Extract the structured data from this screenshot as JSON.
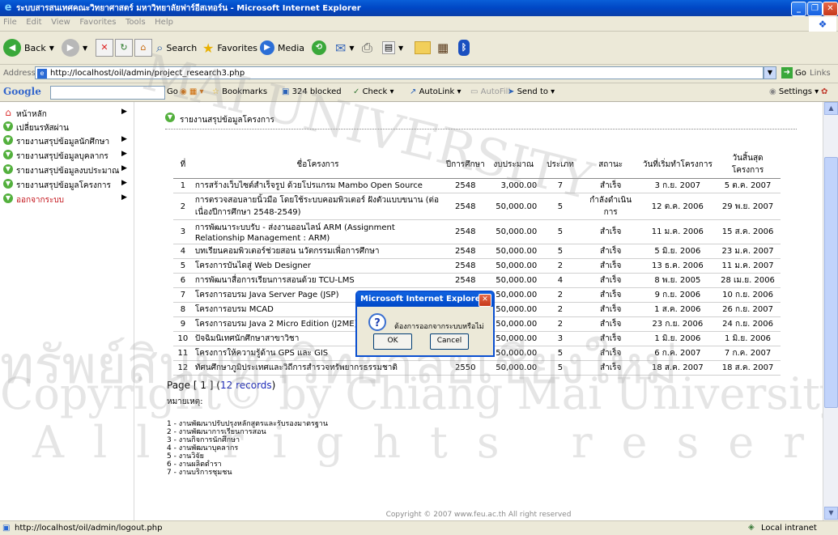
{
  "window": {
    "title": "ระบบสารสนเทศคณะวิทยาศาสตร์ มหาวิทยาลัยฟาร์อีสเทอร์น - Microsoft Internet Explorer"
  },
  "menu": [
    "File",
    "Edit",
    "View",
    "Favorites",
    "Tools",
    "Help"
  ],
  "toolbar": {
    "back": "Back",
    "search": "Search",
    "favorites": "Favorites",
    "media": "Media"
  },
  "address": {
    "label": "Address",
    "url": "http://localhost/oil/admin/project_research3.php",
    "go": "Go",
    "links": "Links"
  },
  "googlebar": {
    "logo": "Google",
    "go": "Go",
    "bookmarks": "Bookmarks",
    "blocked": "324 blocked",
    "check": "Check",
    "autolink": "AutoLink",
    "autofill": "AutoFill",
    "sendto": "Send to",
    "settings": "Settings"
  },
  "nav": [
    {
      "label": "หน้าหลัก",
      "icon": "home-icon"
    },
    {
      "label": "เปลี่ยนรหัสผ่าน",
      "icon": "bullet-icon"
    },
    {
      "label": "รายงานสรุปข้อมูลนักศึกษา",
      "icon": "bullet-icon"
    },
    {
      "label": "รายงานสรุปข้อมูลบุคลากร",
      "icon": "bullet-icon"
    },
    {
      "label": "รายงานสรุปข้อมูลงบประมาณ",
      "icon": "bullet-icon"
    },
    {
      "label": "รายงานสรุปข้อมูลโครงการ",
      "icon": "bullet-icon"
    },
    {
      "label": "ออกจากระบบ",
      "icon": "bullet-icon"
    }
  ],
  "section": {
    "title": "รายงานสรุปข้อมูลโครงการ"
  },
  "table": {
    "headers": [
      "ที่",
      "ชื่อโครงการ",
      "ปีการศึกษา",
      "งบประมาณ",
      "ประเภท",
      "สถานะ",
      "วันที่เริ่มทำโครงการ",
      "วันสิ้นสุดโครงการ"
    ],
    "rows": [
      [
        "1",
        "การสร้างเว็บไซต์สำเร็จรูป ด้วยโปรแกรม Mambo Open Source",
        "2548",
        "3,000.00",
        "7",
        "สำเร็จ",
        "3 ก.ย. 2007",
        "5 ต.ค. 2007"
      ],
      [
        "2",
        "การตรวจสอบลายนิ้วมือ โดยใช้ระบบคอมพิวเตอร์ ฝังตัวแบบขนาน (ต่อเนื่องปีการศึกษา 2548-2549)",
        "2548",
        "50,000.00",
        "5",
        "กำลังดำเนินการ",
        "12 ต.ค. 2006",
        "29 พ.ย. 2007"
      ],
      [
        "3",
        "การพัฒนาระบบรับ - ส่งงานออนไลน์ ARM (Assignment Relationship Management : ARM)",
        "2548",
        "50,000.00",
        "5",
        "สำเร็จ",
        "11 ม.ค. 2006",
        "15 ส.ค. 2006"
      ],
      [
        "4",
        "บทเรียนคอมพิวเตอร์ช่วยสอน นวัตกรรมเพื่อการศึกษา",
        "2548",
        "50,000.00",
        "5",
        "สำเร็จ",
        "5 มิ.ย. 2006",
        "23 ม.ค. 2007"
      ],
      [
        "5",
        "โครงการบันไดสู่ Web Designer",
        "2548",
        "50,000.00",
        "2",
        "สำเร็จ",
        "13 ธ.ค. 2006",
        "11 ม.ค. 2007"
      ],
      [
        "6",
        "การพัฒนาสื่อการเรียนการสอนด้วย TCU-LMS",
        "2548",
        "50,000.00",
        "4",
        "สำเร็จ",
        "8 พ.ย. 2005",
        "28 เม.ย. 2006"
      ],
      [
        "7",
        "โครงการอบรม Java Server Page (JSP)",
        "2548",
        "50,000.00",
        "2",
        "สำเร็จ",
        "9 ก.ย. 2006",
        "10 ก.ย. 2006"
      ],
      [
        "8",
        "โครงการอบรม MCAD",
        "2548",
        "50,000.00",
        "2",
        "สำเร็จ",
        "1 ส.ค. 2006",
        "26 ก.ย. 2007"
      ],
      [
        "9",
        "โครงการอบรม Java 2 Micro Edition (J2ME)",
        "2548",
        "50,000.00",
        "2",
        "สำเร็จ",
        "23 ก.ย. 2006",
        "24 ก.ย. 2006"
      ],
      [
        "10",
        "ปัจฉิมนิเทศนักศึกษาสาขาวิชา",
        "2548",
        "50,000.00",
        "3",
        "สำเร็จ",
        "1 มิ.ย. 2006",
        "1 มิ.ย. 2006"
      ],
      [
        "11",
        "โครงการให้ความรู้ด้าน GPS และ GIS",
        "2550",
        "50,000.00",
        "5",
        "สำเร็จ",
        "6 ก.ค. 2007",
        "7 ก.ค. 2007"
      ],
      [
        "12",
        "ทัศนศึกษาภูมิประเทศและวิถีการสำรวจทรัพยากรธรรมชาติ",
        "2550",
        "50,000.00",
        "5",
        "สำเร็จ",
        "18 ส.ค. 2007",
        "18 ส.ค. 2007"
      ]
    ]
  },
  "paging": {
    "prefix": "Page [ 1 ] (",
    "records": "12 records",
    "suffix": ")"
  },
  "note_label": "หมายเหตุ:",
  "legend": [
    "1 - งานพัฒนาปรับปรุงหลักสูตรและรับรองมาตรฐาน",
    "2 - งานพัฒนาการเรียนการสอน",
    "3 - งานกิจการนักศึกษา",
    "4 - งานพัฒนาบุคลากร",
    "5 - งานวิจัย",
    "6 - งานผลิตตำรา",
    "7 - งานบริการชุมชน"
  ],
  "footer": "Copyright © 2007 www.feu.ac.th All right reserved",
  "status": {
    "url": "http://localhost/oil/admin/logout.php",
    "zone": "Local intranet"
  },
  "dialog": {
    "title": "Microsoft Internet Explorer",
    "message": "ต้องการออกจากระบบหรือไม่",
    "ok": "OK",
    "cancel": "Cancel"
  },
  "watermark": {
    "lines": [
      "MAI UNIVERSITY",
      "ทรัพย์สินมหาวิทยาลัยเชียงใหม่",
      "Copyright© by Chiang Mai University",
      "All rights reserved"
    ]
  }
}
